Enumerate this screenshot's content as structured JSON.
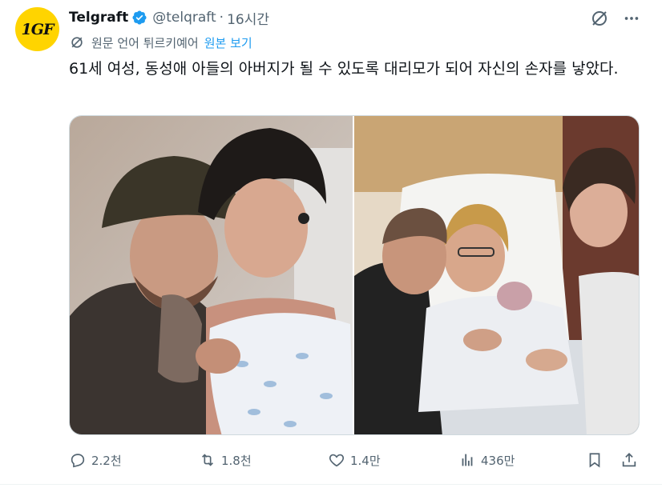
{
  "author": {
    "display_name": "Telgraft",
    "handle": "@telqraft",
    "time": "16시간",
    "avatar_text": "1GF",
    "verified": true
  },
  "translation": {
    "note": "원문 언어 튀르키예어",
    "show_original": "원본 보기"
  },
  "tweet": {
    "text": "61세 여성, 동성애 아들의 아버지가 될 수 있도록 대리모가 되어 자신의 손자를 낳았다."
  },
  "media": {
    "count": 2
  },
  "actions": {
    "replies": "2.2천",
    "retweets": "1.8천",
    "likes": "1.4만",
    "views": "436만"
  },
  "icons": {
    "grok": "grok-icon",
    "more": "more-icon",
    "translate": "translate-icon",
    "reply": "reply-icon",
    "retweet": "retweet-icon",
    "like": "heart-icon",
    "views": "views-icon",
    "bookmark": "bookmark-icon",
    "share": "share-icon"
  },
  "colors": {
    "text": "#0f1419",
    "secondary": "#536471",
    "link": "#1d9bf0",
    "verified": "#1d9bf0",
    "avatar_bg": "#ffd400"
  }
}
